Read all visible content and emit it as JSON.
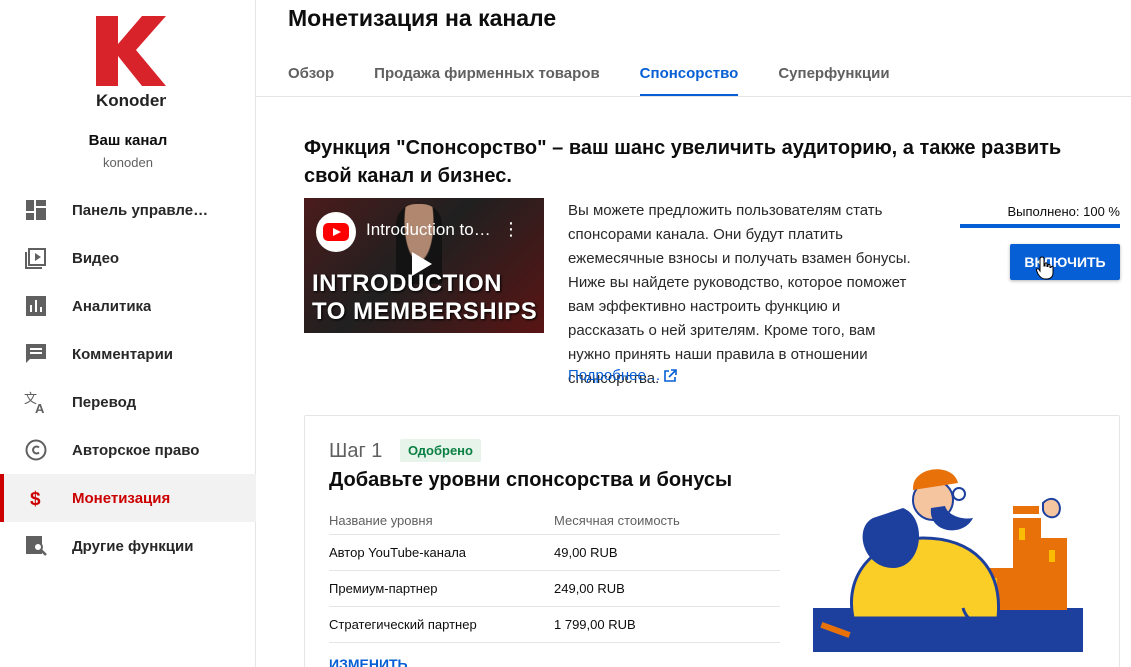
{
  "sidebar": {
    "logo_text": "Konoden",
    "channel_name": "Ваш канал",
    "channel_handle": "konoden",
    "items": [
      {
        "label": "Панель управлен…",
        "icon": "dashboard-icon"
      },
      {
        "label": "Видео",
        "icon": "video-icon"
      },
      {
        "label": "Аналитика",
        "icon": "analytics-icon"
      },
      {
        "label": "Комментарии",
        "icon": "comments-icon"
      },
      {
        "label": "Перевод",
        "icon": "translate-icon"
      },
      {
        "label": "Авторское право",
        "icon": "copyright-icon"
      },
      {
        "label": "Монетизация",
        "icon": "dollar-icon",
        "active": true
      },
      {
        "label": "Другие функции",
        "icon": "other-features-icon"
      }
    ]
  },
  "main": {
    "title": "Монетизация на канале",
    "tabs": [
      {
        "label": "Обзор"
      },
      {
        "label": "Продажа фирменных товаров"
      },
      {
        "label": "Спонсорство",
        "active": true
      },
      {
        "label": "Суперфункции"
      }
    ],
    "headline": "Функция \"Спонсорство\" – ваш шанс увеличить аудиторию, а также развить свой канал и бизнес.",
    "video": {
      "title": "Introduction to…",
      "overlay_line1": "INTRODUCTION",
      "overlay_line2": "TO MEMBERSHIPS"
    },
    "description": "Вы можете предложить пользователям стать спонсорами канала. Они будут платить ежемесячные взносы и получать взамен бонусы. Ниже вы найдете руководство, которое поможет вам эффективно настроить функцию и рассказать о ней зрителям. Кроме того, вам нужно принять наши правила в отношении спонсорства.",
    "more_link": "Подробнее…",
    "progress": {
      "label": "Выполнено: 100 %",
      "value": 100
    },
    "enable_button": "ВКЛЮЧИТЬ",
    "step": {
      "label": "Шаг 1",
      "badge": "Одобрено",
      "title": "Добавьте уровни спонсорства и бонусы",
      "columns": [
        "Название уровня",
        "Месячная стоимость"
      ],
      "rows": [
        [
          "Автор YouTube-канала",
          "49,00 RUB"
        ],
        [
          "Премиум-партнер",
          "249,00 RUB"
        ],
        [
          "Стратегический партнер",
          "1 799,00 RUB"
        ]
      ],
      "change_link": "ИЗМЕНИТЬ"
    }
  },
  "colors": {
    "accent": "#065fd4",
    "brand_red": "#cc0000",
    "approved_green": "#0b8043"
  }
}
